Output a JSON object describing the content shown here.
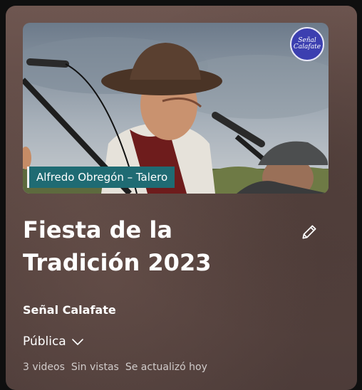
{
  "playlist": {
    "thumbnail": {
      "caption": "Alfredo Obregón – Talero",
      "logo_text": "Señal Calafate"
    },
    "title": "Fiesta de la Tradición 2023",
    "channel": "Señal Calafate",
    "privacy": "Pública",
    "stats": {
      "videos": "3 videos",
      "views": "Sin vistas",
      "updated": "Se actualizó hoy"
    },
    "icons": {
      "edit": "pencil-icon",
      "privacy_dropdown": "chevron-down-icon"
    }
  },
  "colors": {
    "panel_top": "#6e5650",
    "panel_bottom": "#4d3c39",
    "caption_bg": "#1f6b73",
    "logo_bg": "#3c3fb0",
    "meta_text": "rgba(255,255,255,0.72)"
  }
}
